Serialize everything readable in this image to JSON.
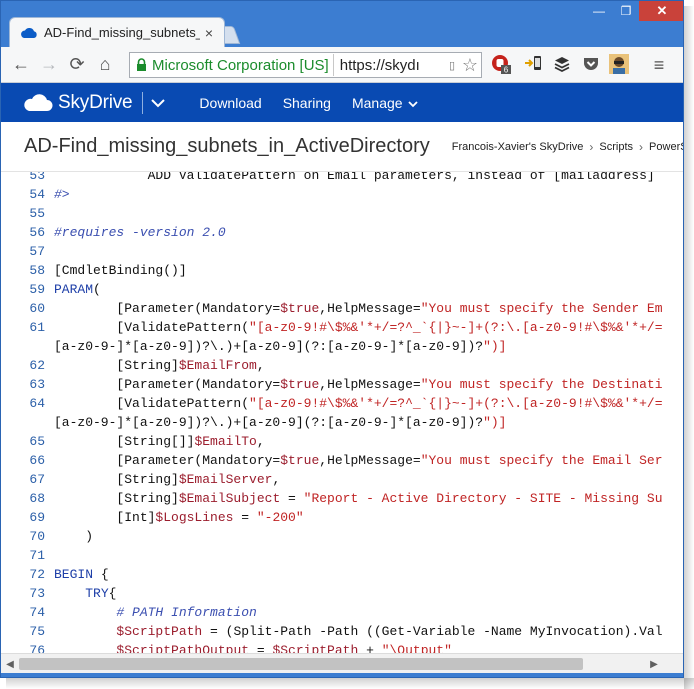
{
  "browser": {
    "tab_title": "AD-Find_missing_subnets_in_ActiveD",
    "tab_close": "×",
    "ev_cert_label": "Microsoft Corporation [US]",
    "url_text": "https://skydı",
    "window_controls": {
      "minimize": "—",
      "maximize": "❐",
      "close": "✕"
    },
    "toolbar_glyphs": {
      "back": "←",
      "forward": "→",
      "reload": "⟳",
      "home": "⌂",
      "star": "☆",
      "menu": "≡"
    },
    "extension_badge": "6"
  },
  "skydrive": {
    "logo_text": "SkyDrive",
    "nav": [
      {
        "label": "Download"
      },
      {
        "label": "Sharing"
      },
      {
        "label": "Manage"
      }
    ],
    "manage_chevron": "⌄"
  },
  "file": {
    "title": "AD-Find_missing_subnets_in_ActiveDirectory",
    "breadcrumbs": [
      "Francois-Xavier's SkyDrive",
      "Scripts",
      "PowerS"
    ],
    "separator": "›"
  },
  "colors": {
    "frame": "#3c7dd1",
    "skydrive_header": "#094ab2",
    "line_number": "#2b5fa8",
    "keyword": "#1e3fa8",
    "comment": "#3b4fb0",
    "string": "#c02424",
    "variable": "#9b1d2d",
    "ev_green": "#1b8c2c"
  },
  "code": {
    "lines": [
      {
        "n": "53",
        "t": "            ADD ValidatePattern on Email parameters, instead of [mailaddress]"
      },
      {
        "n": "54",
        "t": "#>"
      },
      {
        "n": "55",
        "t": ""
      },
      {
        "n": "56",
        "t": "#requires -version 2.0"
      },
      {
        "n": "57",
        "t": ""
      },
      {
        "n": "58",
        "t": "[CmdletBinding()]"
      },
      {
        "n": "59",
        "t": "PARAM("
      },
      {
        "n": "60",
        "t": "        [Parameter(Mandatory=$true,HelpMessage=\"You must specify the Sender Em"
      },
      {
        "n": "61",
        "t": "        [ValidatePattern(\"[a-z0-9!#\\$%&'*+/=?^_`{|}~-]+(?:\\.[a-z0-9!#\\$%&'*+/="
      },
      {
        "n": "",
        "t": "[a-z0-9-]*[a-z0-9])?\\.)+[a-z0-9](?:[a-z0-9-]*[a-z0-9])?\")]"
      },
      {
        "n": "62",
        "t": "        [String]$EmailFrom,"
      },
      {
        "n": "63",
        "t": "        [Parameter(Mandatory=$true,HelpMessage=\"You must specify the Destinati"
      },
      {
        "n": "64",
        "t": "        [ValidatePattern(\"[a-z0-9!#\\$%&'*+/=?^_`{|}~-]+(?:\\.[a-z0-9!#\\$%&'*+/="
      },
      {
        "n": "",
        "t": "[a-z0-9-]*[a-z0-9])?\\.)+[a-z0-9](?:[a-z0-9-]*[a-z0-9])?\")]"
      },
      {
        "n": "65",
        "t": "        [String[]]$EmailTo,"
      },
      {
        "n": "66",
        "t": "        [Parameter(Mandatory=$true,HelpMessage=\"You must specify the Email Ser"
      },
      {
        "n": "67",
        "t": "        [String]$EmailServer,"
      },
      {
        "n": "68",
        "t": "        [String]$EmailSubject = \"Report - Active Directory - SITE - Missing Su"
      },
      {
        "n": "69",
        "t": "        [Int]$LogsLines = \"-200\""
      },
      {
        "n": "70",
        "t": "    )"
      },
      {
        "n": "71",
        "t": ""
      },
      {
        "n": "72",
        "t": "BEGIN {"
      },
      {
        "n": "73",
        "t": "    TRY{"
      },
      {
        "n": "74",
        "t": "        # PATH Information"
      },
      {
        "n": "75",
        "t": "        $ScriptPath = (Split-Path -Path ((Get-Variable -Name MyInvocation).Val"
      },
      {
        "n": "76",
        "t": "        $ScriptPathOutput = $ScriptPath + \"\\Output\""
      }
    ]
  }
}
